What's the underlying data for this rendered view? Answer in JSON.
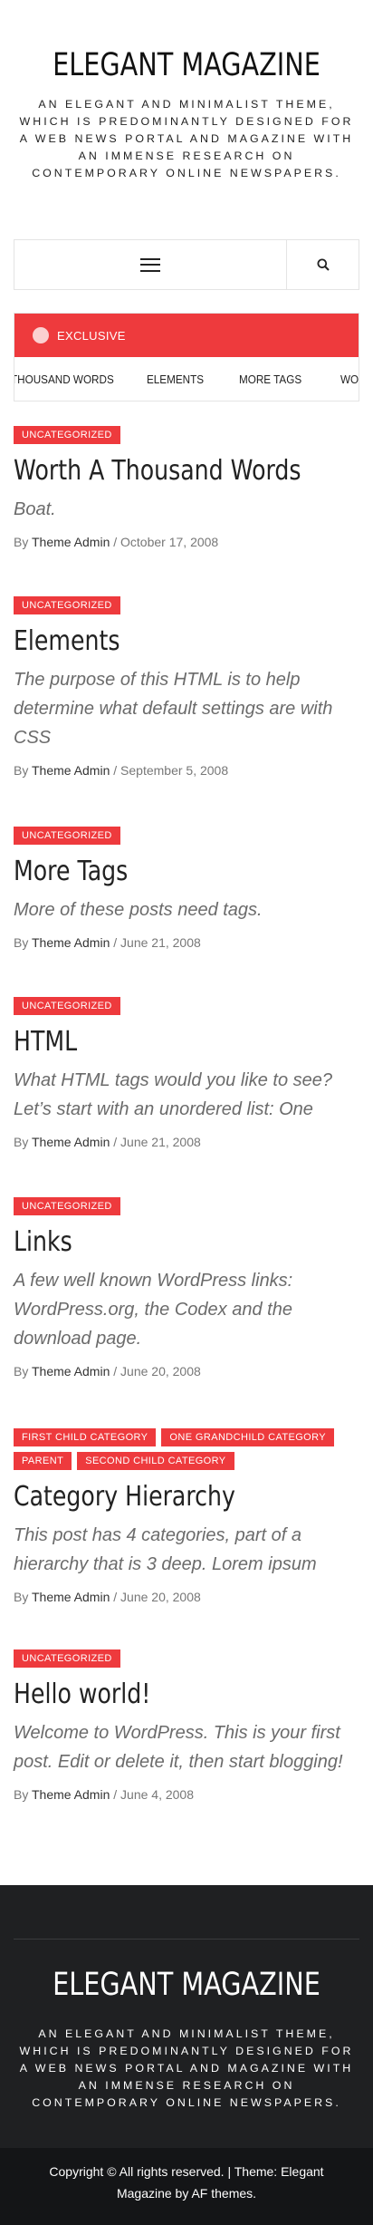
{
  "header": {
    "site_title": "ELEGANT MAGAZINE",
    "site_description": "AN ELEGANT AND MINIMALIST THEME, WHICH IS PREDOMINANTLY DESIGNED FOR A WEB NEWS PORTAL AND MAGAZINE WITH AN IMMENSE RESEARCH ON CONTEMPORARY ONLINE NEWSPAPERS."
  },
  "nav": {
    "menu_icon": "hamburger-icon",
    "search_icon": "search-icon"
  },
  "ticker": {
    "label": "EXCLUSIVE",
    "items": [
      "THOUSAND WORDS",
      "ELEMENTS",
      "MORE TAGS",
      "WO"
    ]
  },
  "posts": [
    {
      "categories": [
        "UNCATEGORIZED"
      ],
      "title": "Worth A Thousand Words",
      "excerpt": "Boat.",
      "author": "Theme Admin",
      "date": "October 17, 2008"
    },
    {
      "categories": [
        "UNCATEGORIZED"
      ],
      "title": "Elements",
      "excerpt": "The purpose of this HTML is to help determine what default settings are with CSS",
      "author": "Theme Admin",
      "date": "September 5, 2008"
    },
    {
      "categories": [
        "UNCATEGORIZED"
      ],
      "title": "More Tags",
      "excerpt": "More of these posts need tags.",
      "author": "Theme Admin",
      "date": "June 21, 2008"
    },
    {
      "categories": [
        "UNCATEGORIZED"
      ],
      "title": "HTML",
      "excerpt": "What HTML tags would you like to see? Let’s start with an unordered list: One",
      "author": "Theme Admin",
      "date": "June 21, 2008"
    },
    {
      "categories": [
        "UNCATEGORIZED"
      ],
      "title": "Links",
      "excerpt": "A few well known WordPress links: WordPress.org, the Codex and the download page.",
      "author": "Theme Admin",
      "date": "June 20, 2008"
    },
    {
      "categories": [
        "FIRST CHILD CATEGORY",
        "ONE GRANDCHILD CATEGORY",
        "PARENT",
        "SECOND CHILD CATEGORY"
      ],
      "title": "Category Hierarchy",
      "excerpt": "This post has 4 categories, part of a hierarchy that is 3 deep. Lorem ipsum",
      "author": "Theme Admin",
      "date": "June 20, 2008"
    },
    {
      "categories": [
        "UNCATEGORIZED"
      ],
      "title": "Hello world!",
      "excerpt": "Welcome to WordPress. This is your first post. Edit or delete it, then start blogging!",
      "author": "Theme Admin",
      "date": "June 4, 2008"
    }
  ],
  "meta_prefix": "By",
  "meta_sep": "/",
  "footer": {
    "site_title": "ELEGANT MAGAZINE",
    "site_description": "AN ELEGANT AND MINIMALIST THEME, WHICH IS PREDOMINANTLY DESIGNED FOR A WEB NEWS PORTAL AND MAGAZINE WITH AN IMMENSE RESEARCH ON CONTEMPORARY ONLINE NEWSPAPERS.",
    "copyright": "Copyright © All rights reserved. | Theme: Elegant Magazine by AF themes."
  },
  "colors": {
    "accent": "#ee3a3d",
    "footer_bg": "#1f2022",
    "copyright_bg": "#141517"
  }
}
